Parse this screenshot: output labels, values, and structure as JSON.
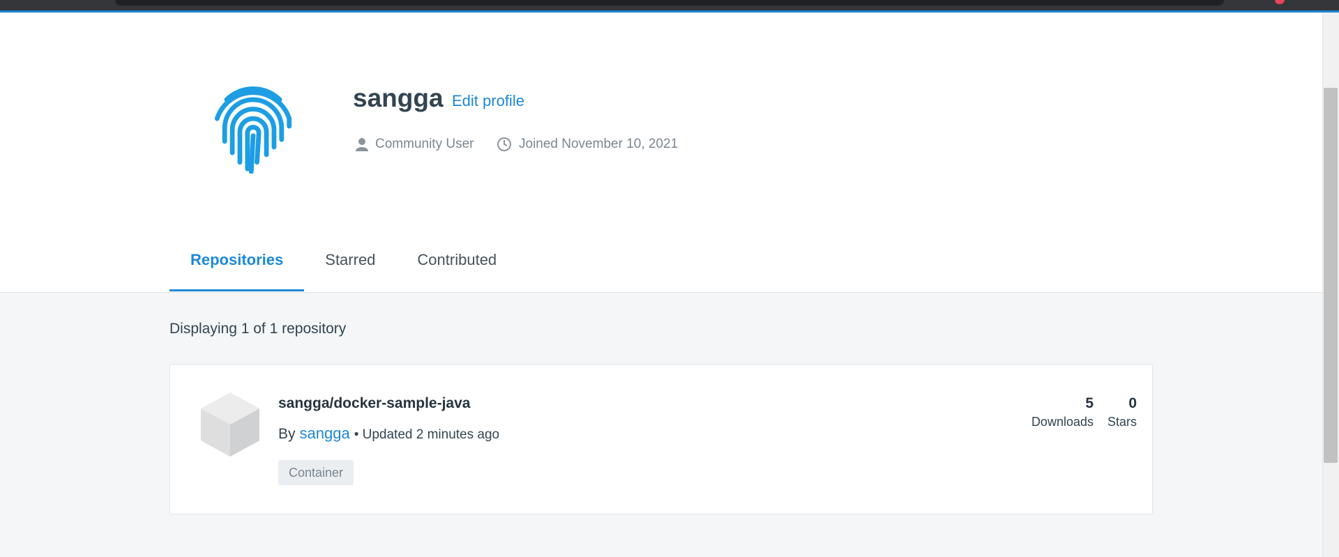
{
  "profile": {
    "username": "sangga",
    "edit_label": "Edit profile",
    "role": "Community User",
    "joined": "Joined November 10, 2021"
  },
  "tabs": [
    {
      "label": "Repositories",
      "active": true
    },
    {
      "label": "Starred",
      "active": false
    },
    {
      "label": "Contributed",
      "active": false
    }
  ],
  "repo_list": {
    "summary": "Displaying 1 of 1 repository",
    "items": [
      {
        "name": "sangga/docker-sample-java",
        "by_label": "By",
        "owner": "sangga",
        "updated": "• Updated 2 minutes ago",
        "badge": "Container",
        "downloads": "5",
        "downloads_label": "Downloads",
        "stars": "0",
        "stars_label": "Stars"
      }
    ]
  },
  "colors": {
    "accent": "#1d88d6",
    "text": "#27343f",
    "muted": "#7a8690",
    "content_bg": "#f5f6f8"
  },
  "icons": [
    "fingerprint-avatar-icon",
    "user-icon",
    "clock-icon",
    "cube-icon"
  ]
}
